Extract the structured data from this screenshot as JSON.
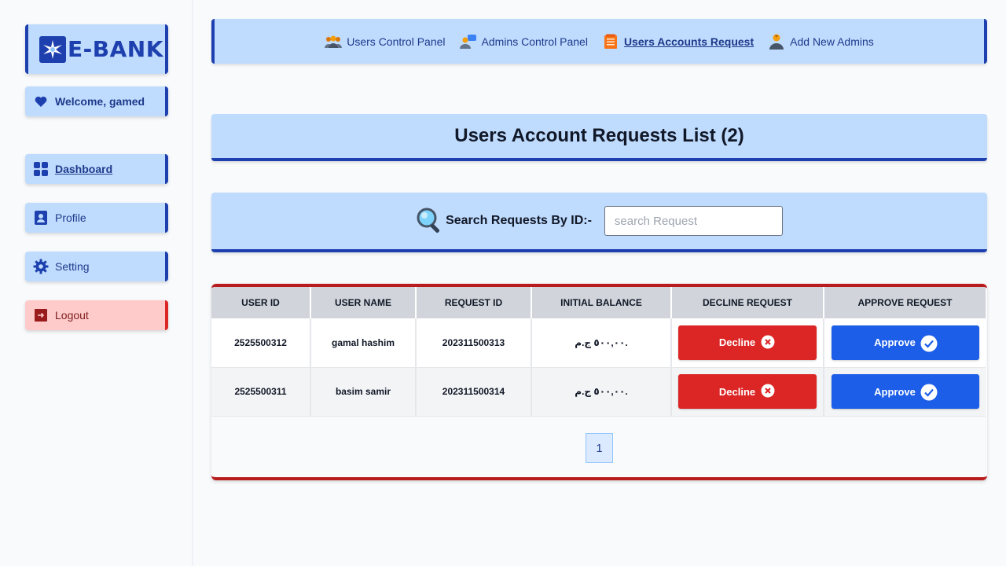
{
  "brand": {
    "name": "E-BANK"
  },
  "sidebar": {
    "welcome": "Welcome, gamed",
    "items": [
      {
        "label": "Dashboard",
        "icon": "grid-icon"
      },
      {
        "label": "Profile",
        "icon": "user-card-icon"
      },
      {
        "label": "Setting",
        "icon": "gear-icon"
      },
      {
        "label": "Logout",
        "icon": "logout-icon"
      }
    ]
  },
  "nav": {
    "items": [
      {
        "label": "Users Control Panel",
        "icon": "users-group-icon"
      },
      {
        "label": "Admins Control Panel",
        "icon": "admin-chat-icon"
      },
      {
        "label": "Users Accounts Request",
        "icon": "document-list-icon",
        "active": true
      },
      {
        "label": "Add New Admins",
        "icon": "user-add-icon"
      }
    ]
  },
  "title": "Users Account Requests List (2)",
  "search": {
    "label": "Search Requests By ID:-",
    "placeholder": "search Request",
    "value": ""
  },
  "table": {
    "headers": [
      "USER ID",
      "USER NAME",
      "REQUEST ID",
      "INITIAL BALANCE",
      "DECLINE REQUEST",
      "APPROVE REQUEST"
    ],
    "rows": [
      {
        "user_id": "2525500312",
        "user_name": "gamal hashim",
        "request_id": "202311500313",
        "balance": "٥٠٠,٠٠ ج.م.",
        "decline": "Decline",
        "approve": "Approve"
      },
      {
        "user_id": "2525500311",
        "user_name": "basim samir",
        "request_id": "202311500314",
        "balance": "٥٠٠,٠٠ ج.م.",
        "decline": "Decline",
        "approve": "Approve"
      }
    ]
  },
  "pagination": {
    "current": "1"
  },
  "colors": {
    "accent": "#1e40af",
    "panel": "#bfdbfe",
    "danger": "#dc2626",
    "approve": "#1d5ee8"
  }
}
